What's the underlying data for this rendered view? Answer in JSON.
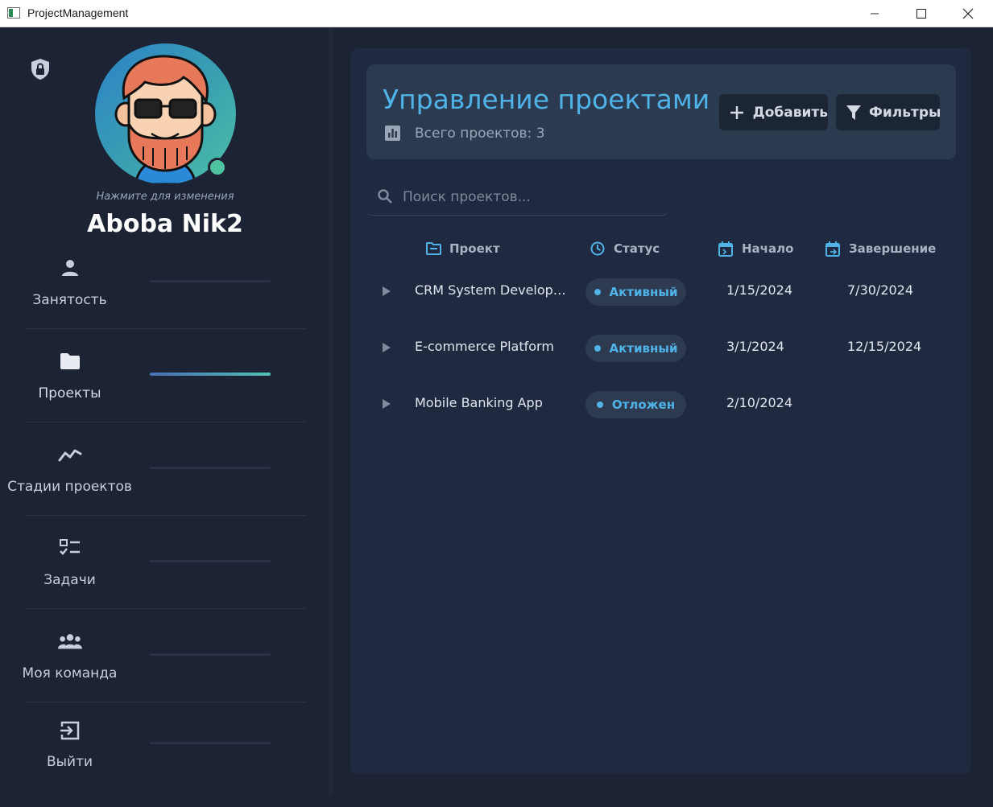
{
  "window": {
    "title": "ProjectManagement",
    "minimize": "—",
    "maximize": "☐",
    "close": "✕"
  },
  "sidebar": {
    "avatar_hint": "Нажмите для изменения",
    "user_name": "Aboba Nik2",
    "items": [
      {
        "label": "Занятость",
        "icon": "person-icon",
        "active": false
      },
      {
        "label": "Проекты",
        "icon": "folder-icon",
        "active": true
      },
      {
        "label": "Стадии проектов",
        "icon": "trend-line-icon",
        "active": false
      },
      {
        "label": "Задачи",
        "icon": "checklist-icon",
        "active": false
      },
      {
        "label": "Моя команда",
        "icon": "group-icon",
        "active": false
      },
      {
        "label": "Выйти",
        "icon": "logout-icon",
        "active": false
      }
    ]
  },
  "header": {
    "title": "Управление проектами",
    "stats": "Всего проектов: 3",
    "add_label": "Добавить",
    "filter_label": "Фильтры"
  },
  "search": {
    "placeholder": "Поиск проектов...",
    "value": ""
  },
  "table": {
    "columns": [
      "Проект",
      "Статус",
      "Начало",
      "Завершение"
    ],
    "rows": [
      {
        "name": "CRM System Developm...",
        "status": "Активный",
        "start": "1/15/2024",
        "end": "7/30/2024"
      },
      {
        "name": "E-commerce Platform",
        "status": "Активный",
        "start": "3/1/2024",
        "end": "12/15/2024"
      },
      {
        "name": "Mobile Banking App",
        "status": "Отложен",
        "start": "2/10/2024",
        "end": ""
      }
    ]
  },
  "colors": {
    "accent": "#4fb3e8",
    "background": "#1c2334",
    "panel": "#1f2940",
    "card": "#2c3a50",
    "online": "#4fc3a1"
  }
}
